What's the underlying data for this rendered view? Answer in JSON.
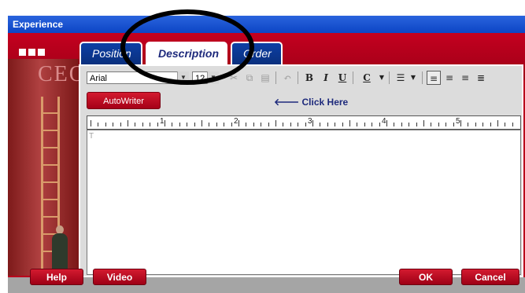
{
  "window": {
    "title": "Experience"
  },
  "tabs": [
    {
      "label": "Position",
      "state": "inactive"
    },
    {
      "label": "Description",
      "state": "active"
    },
    {
      "label": "Order",
      "state": "inactive"
    }
  ],
  "toolbar": {
    "font": "Arial",
    "size": "12",
    "bold": "B",
    "italic": "I",
    "underline": "U",
    "color": "C"
  },
  "editor": {
    "autowriter_label": "AutoWriter",
    "hint": "Click Here",
    "ruler_numbers": [
      "1",
      "2",
      "3",
      "4",
      "5"
    ],
    "placeholder_marker": "T"
  },
  "footer": {
    "help": "Help",
    "video": "Video",
    "ok": "OK",
    "cancel": "Cancel"
  },
  "sidebar": {
    "poster_text": "CEO"
  },
  "colors": {
    "window_red": "#b9001c",
    "title_blue": "#1d56d6",
    "tab_blue": "#0c3fa5"
  }
}
